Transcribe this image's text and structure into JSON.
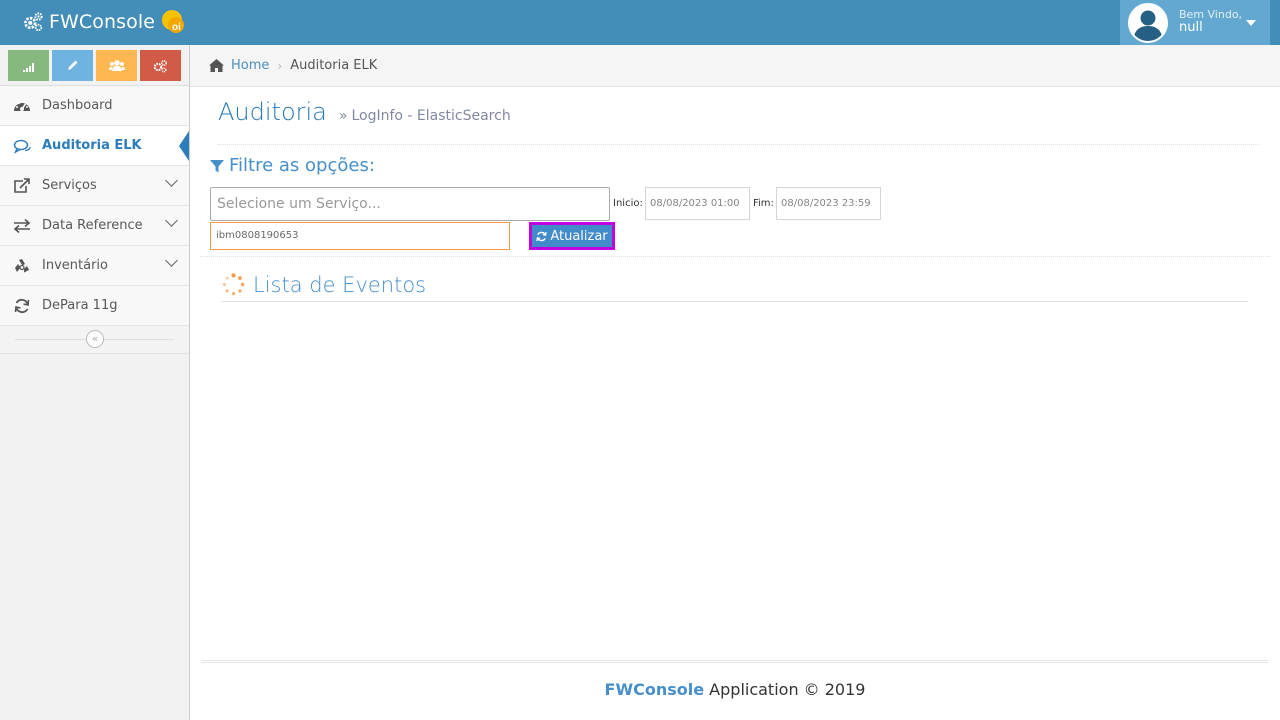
{
  "app": {
    "title": "FWConsole",
    "badge": "oi"
  },
  "user": {
    "greeting": "Bem Vindo,",
    "name": "null"
  },
  "colors": {
    "navbar": "#438eb9",
    "accent": "#2b7dbc",
    "highlight_border": "#c000e0",
    "input_focus": "#f59942"
  },
  "shortcuts": [
    {
      "icon": "signal-icon",
      "color": "#87b87f"
    },
    {
      "icon": "pencil-icon",
      "color": "#6fb3e0"
    },
    {
      "icon": "users-icon",
      "color": "#ffb752"
    },
    {
      "icon": "cogs-icon",
      "color": "#d15b47"
    }
  ],
  "sidebar": {
    "items": [
      {
        "label": "Dashboard",
        "icon": "tachometer-icon",
        "expandable": false,
        "active": false
      },
      {
        "label": "Auditoria ELK",
        "icon": "comments-icon",
        "expandable": false,
        "active": true
      },
      {
        "label": "Serviços",
        "icon": "external-link-icon",
        "expandable": true,
        "active": false
      },
      {
        "label": "Data Reference",
        "icon": "exchange-icon",
        "expandable": true,
        "active": false
      },
      {
        "label": "Inventário",
        "icon": "recycle-icon",
        "expandable": true,
        "active": false
      },
      {
        "label": "DePara 11g",
        "icon": "refresh-icon",
        "expandable": false,
        "active": false
      }
    ],
    "collapse_glyph": "«"
  },
  "breadcrumb": {
    "home": "Home",
    "separator": "›",
    "current": "Auditoria ELK"
  },
  "page": {
    "title": "Auditoria",
    "subtitle_glyph": "»",
    "subtitle": "LogInfo - ElasticSearch"
  },
  "filter": {
    "title": "Filtre as opções:",
    "service_placeholder": "Selecione um Serviço...",
    "start_label": "Inicio:",
    "start_value": "08/08/2023 01:00",
    "end_label": "Fim:",
    "end_value": "08/08/2023 23:59",
    "search_value": "ibm0808190653",
    "update_button": "Atualizar"
  },
  "events": {
    "title": "Lista de Eventos"
  },
  "footer": {
    "brand": "FWConsole",
    "text": " Application © 2019"
  }
}
